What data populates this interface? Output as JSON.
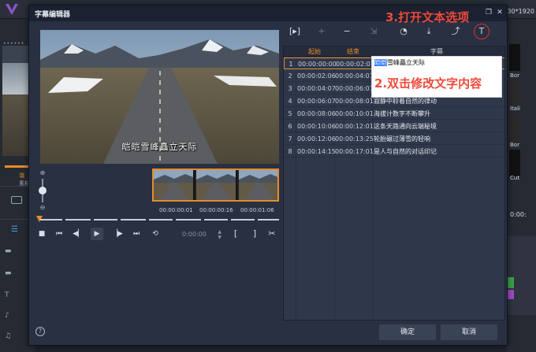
{
  "background_app": {
    "resolution_fragment": "30*1920",
    "left_labels": [
      "谐",
      "素材"
    ],
    "right_thumbs": [
      "Bor",
      "Itali",
      "Bor",
      "Cut"
    ],
    "timecode": "0:00:"
  },
  "dialog": {
    "title": "字幕编辑器",
    "buttons": {
      "restore": "❐",
      "close": "✕"
    },
    "ok_label": "确定",
    "cancel_label": "取消",
    "help_label": "?"
  },
  "preview": {
    "subtitle_overlay": "皑皑雪峰矗立天际"
  },
  "timeline": {
    "timecodes": [
      "00:00:00:01",
      "00:00:00:16",
      "00:00:01:06"
    ],
    "time_field": "0:00:00"
  },
  "annotations": {
    "step3": "3.打开文本选项",
    "step2": "2.双击修改文字内容"
  },
  "table": {
    "headers": {
      "start": "起始",
      "end": "结束",
      "text": "字幕"
    },
    "rows": [
      {
        "num": "1",
        "start": "00:00:00:00",
        "end": "00:00:02:01",
        "text": ""
      },
      {
        "num": "2",
        "start": "00:00:02:06",
        "end": "00:00:04:01",
        "text": ""
      },
      {
        "num": "3",
        "start": "00:00:04:07",
        "end": "00:00:06:01",
        "text": ""
      },
      {
        "num": "4",
        "start": "00:00:06:07",
        "end": "00:00:08:01",
        "text": "寂静中聆着自然的律动"
      },
      {
        "num": "5",
        "start": "00:00:08:06",
        "end": "00:00:10:01",
        "text": "海拔计数字不断攀升"
      },
      {
        "num": "6",
        "start": "00:00:10:06",
        "end": "00:00:12:01",
        "text": "这条天路通向云端秘境"
      },
      {
        "num": "7",
        "start": "00:00:12:06",
        "end": "00:00:13:25",
        "text": "轮胎碾过薄雪的轻响"
      },
      {
        "num": "8",
        "start": "00:00:14:15",
        "end": "00:00:17:01",
        "text": "是人与自然的对话印记"
      }
    ],
    "edit": {
      "highlight": "皑皑",
      "rest": "雪峰矗立天际"
    }
  },
  "colors": {
    "accent_orange": "#e98b2c",
    "annotation_red": "#f04a3b",
    "header_orange": "#e98b2c",
    "selection_blue": "#3377ff"
  }
}
